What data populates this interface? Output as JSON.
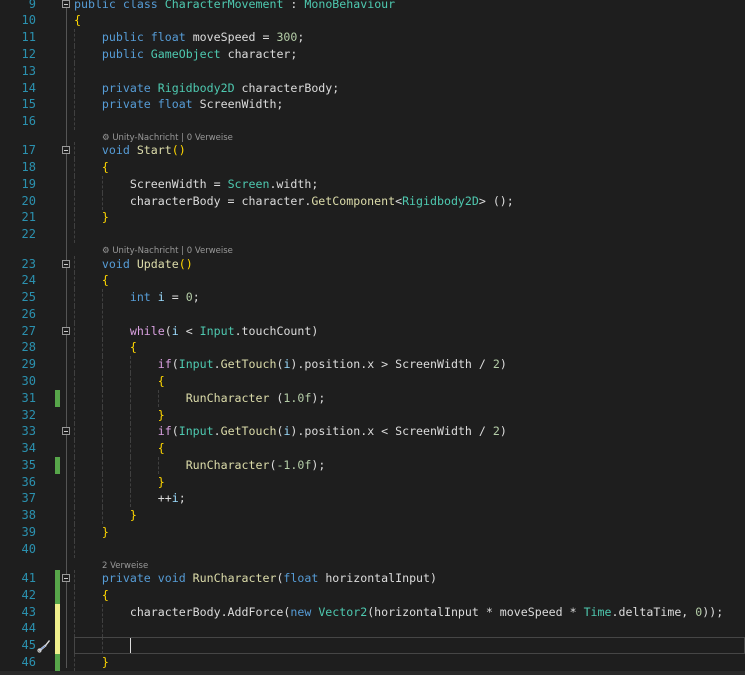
{
  "editor": {
    "current_line": 45,
    "change_colors": {
      "saved": "#57a64a",
      "unsaved": "#efef8c"
    },
    "quick_action_icon": "screwdriver-brush-icon",
    "lines": [
      {
        "n": 9,
        "fold": true,
        "t": [
          [
            "kw",
            "public "
          ],
          [
            "kw",
            "class "
          ],
          [
            "type",
            "CharacterMovement"
          ],
          [
            "p",
            " : "
          ],
          [
            "type",
            "MonoBehaviour"
          ]
        ]
      },
      {
        "n": 10,
        "t": [
          [
            "br",
            "{"
          ]
        ]
      },
      {
        "n": 11,
        "t": [
          [
            "p",
            "    "
          ],
          [
            "kw",
            "public "
          ],
          [
            "kw",
            "float "
          ],
          [
            "p",
            "moveSpeed = "
          ],
          [
            "num",
            "300"
          ],
          [
            "p",
            ";"
          ]
        ]
      },
      {
        "n": 12,
        "t": [
          [
            "p",
            "    "
          ],
          [
            "kw",
            "public "
          ],
          [
            "type",
            "GameObject"
          ],
          [
            "p",
            " character;"
          ]
        ]
      },
      {
        "n": 13,
        "t": []
      },
      {
        "n": 14,
        "t": [
          [
            "p",
            "    "
          ],
          [
            "kw",
            "private "
          ],
          [
            "type",
            "Rigidbody2D"
          ],
          [
            "p",
            " characterBody;"
          ]
        ]
      },
      {
        "n": 15,
        "t": [
          [
            "p",
            "    "
          ],
          [
            "kw",
            "private "
          ],
          [
            "kw",
            "float "
          ],
          [
            "p",
            "ScreenWidth;"
          ]
        ]
      },
      {
        "n": 16,
        "t": []
      },
      {
        "n": 17,
        "fold": true,
        "lens": "Unity-Nachricht | 0 Verweise",
        "t": [
          [
            "p",
            "    "
          ],
          [
            "kw",
            "void "
          ],
          [
            "fn",
            "Start"
          ],
          [
            "br",
            "()"
          ]
        ]
      },
      {
        "n": 18,
        "t": [
          [
            "p",
            "    "
          ],
          [
            "br",
            "{"
          ]
        ]
      },
      {
        "n": 19,
        "t": [
          [
            "p",
            "        ScreenWidth = "
          ],
          [
            "type",
            "Screen"
          ],
          [
            "p",
            ".width;"
          ]
        ]
      },
      {
        "n": 20,
        "t": [
          [
            "p",
            "        characterBody = character."
          ],
          [
            "fn",
            "GetComponent"
          ],
          [
            "p",
            "<"
          ],
          [
            "type",
            "Rigidbody2D"
          ],
          [
            "p",
            "> ();"
          ]
        ]
      },
      {
        "n": 21,
        "t": [
          [
            "p",
            "    "
          ],
          [
            "br",
            "}"
          ]
        ]
      },
      {
        "n": 22,
        "t": []
      },
      {
        "n": 23,
        "fold": true,
        "lens": "Unity-Nachricht | 0 Verweise",
        "t": [
          [
            "p",
            "    "
          ],
          [
            "kw",
            "void "
          ],
          [
            "fn",
            "Update"
          ],
          [
            "br",
            "()"
          ]
        ]
      },
      {
        "n": 24,
        "t": [
          [
            "p",
            "    "
          ],
          [
            "br",
            "{"
          ]
        ]
      },
      {
        "n": 25,
        "t": [
          [
            "p",
            "        "
          ],
          [
            "kw",
            "int "
          ],
          [
            "loc",
            "i"
          ],
          [
            "p",
            " = "
          ],
          [
            "num",
            "0"
          ],
          [
            "p",
            ";"
          ]
        ]
      },
      {
        "n": 26,
        "t": []
      },
      {
        "n": 27,
        "fold": true,
        "t": [
          [
            "p",
            "        "
          ],
          [
            "ctl",
            "while"
          ],
          [
            "p",
            "("
          ],
          [
            "loc",
            "i"
          ],
          [
            "p",
            " < "
          ],
          [
            "type",
            "Input"
          ],
          [
            "p",
            ".touchCount)"
          ]
        ]
      },
      {
        "n": 28,
        "t": [
          [
            "p",
            "        "
          ],
          [
            "br",
            "{"
          ]
        ]
      },
      {
        "n": 29,
        "t": [
          [
            "p",
            "            "
          ],
          [
            "ctl",
            "if"
          ],
          [
            "p",
            "("
          ],
          [
            "type",
            "Input"
          ],
          [
            "p",
            "."
          ],
          [
            "fn",
            "GetTouch"
          ],
          [
            "p",
            "("
          ],
          [
            "loc",
            "i"
          ],
          [
            "p",
            ").position.x > ScreenWidth / "
          ],
          [
            "num",
            "2"
          ],
          [
            "p",
            ")"
          ]
        ]
      },
      {
        "n": 30,
        "t": [
          [
            "p",
            "            "
          ],
          [
            "br",
            "{"
          ]
        ]
      },
      {
        "n": 31,
        "chg": "saved",
        "t": [
          [
            "p",
            "                "
          ],
          [
            "fn",
            "RunCharacter"
          ],
          [
            "p",
            " ("
          ],
          [
            "num",
            "1.0f"
          ],
          [
            "p",
            ");"
          ]
        ]
      },
      {
        "n": 32,
        "t": [
          [
            "p",
            "            "
          ],
          [
            "br",
            "}"
          ]
        ]
      },
      {
        "n": 33,
        "fold": true,
        "t": [
          [
            "p",
            "            "
          ],
          [
            "ctl",
            "if"
          ],
          [
            "p",
            "("
          ],
          [
            "type",
            "Input"
          ],
          [
            "p",
            "."
          ],
          [
            "fn",
            "GetTouch"
          ],
          [
            "p",
            "("
          ],
          [
            "loc",
            "i"
          ],
          [
            "p",
            ").position.x < ScreenWidth / "
          ],
          [
            "num",
            "2"
          ],
          [
            "p",
            ")"
          ]
        ]
      },
      {
        "n": 34,
        "t": [
          [
            "p",
            "            "
          ],
          [
            "br",
            "{"
          ]
        ]
      },
      {
        "n": 35,
        "chg": "saved",
        "t": [
          [
            "p",
            "                "
          ],
          [
            "fn",
            "RunCharacter"
          ],
          [
            "p",
            "("
          ],
          [
            "num",
            "-1.0f"
          ],
          [
            "p",
            ");"
          ]
        ]
      },
      {
        "n": 36,
        "t": [
          [
            "p",
            "            "
          ],
          [
            "br",
            "}"
          ]
        ]
      },
      {
        "n": 37,
        "t": [
          [
            "p",
            "            ++"
          ],
          [
            "loc",
            "i"
          ],
          [
            "p",
            ";"
          ]
        ]
      },
      {
        "n": 38,
        "t": [
          [
            "p",
            "        "
          ],
          [
            "br",
            "}"
          ]
        ]
      },
      {
        "n": 39,
        "t": [
          [
            "p",
            "    "
          ],
          [
            "br",
            "}"
          ]
        ]
      },
      {
        "n": 40,
        "t": []
      },
      {
        "n": 41,
        "fold": true,
        "chg": "saved",
        "lens": "2 Verweise",
        "t": [
          [
            "p",
            "    "
          ],
          [
            "kw",
            "private "
          ],
          [
            "kw",
            "void "
          ],
          [
            "fn",
            "RunCharacter"
          ],
          [
            "p",
            "("
          ],
          [
            "kw",
            "float "
          ],
          [
            "p",
            "horizontalInput)"
          ]
        ]
      },
      {
        "n": 42,
        "chg": "saved",
        "t": [
          [
            "p",
            "    "
          ],
          [
            "br",
            "{"
          ]
        ]
      },
      {
        "n": 43,
        "chg": "unsaved",
        "t": [
          [
            "p",
            "        characterBody.AddForce("
          ],
          [
            "kw",
            "new "
          ],
          [
            "type",
            "Vector2"
          ],
          [
            "p",
            "(horizontalInput * moveSpeed * "
          ],
          [
            "type",
            "Time"
          ],
          [
            "p",
            ".deltaTime, "
          ],
          [
            "num",
            "0"
          ],
          [
            "p",
            "));"
          ]
        ]
      },
      {
        "n": 44,
        "chg": "unsaved",
        "t": []
      },
      {
        "n": 45,
        "chg": "unsaved",
        "t": []
      },
      {
        "n": 46,
        "chg": "saved",
        "t": [
          [
            "p",
            "    "
          ],
          [
            "br",
            "}"
          ]
        ]
      }
    ]
  }
}
